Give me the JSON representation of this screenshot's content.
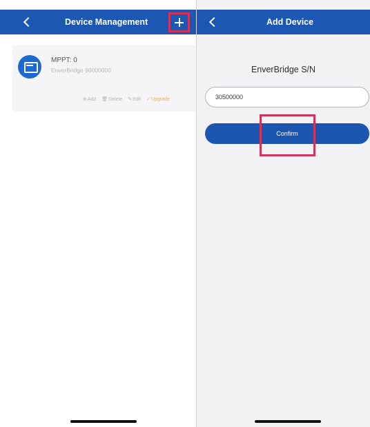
{
  "colors": {
    "nav_blue": "#1c57b4",
    "button_blue": "#1c55b0",
    "avatar_blue": "#1c6ad0",
    "highlight_red": "#d2335a",
    "upgrade_orange": "#f2ae3e"
  },
  "left_screen": {
    "title": "Device Management",
    "back_icon": "chevron-left-icon",
    "add_icon": "plus-icon",
    "device": {
      "icon": "solar-inverter-icon",
      "mppt_label": "MPPT: 0",
      "serial": "EnverBridge 90000000",
      "actions": [
        {
          "icon": "plus-circle-icon",
          "glyph": "⊕",
          "label": "Add"
        },
        {
          "icon": "trash-icon",
          "glyph": "🗑",
          "label": "Delete"
        },
        {
          "icon": "pencil-icon",
          "glyph": "✎",
          "label": "Edit"
        },
        {
          "icon": "upgrade-icon",
          "glyph": "✓",
          "label": "Upgrade"
        }
      ]
    }
  },
  "right_screen": {
    "title": "Add Device",
    "back_icon": "chevron-left-icon",
    "serial_heading": "EnverBridge S/N",
    "serial_value": "30500000",
    "confirm_label": "Confirm"
  }
}
